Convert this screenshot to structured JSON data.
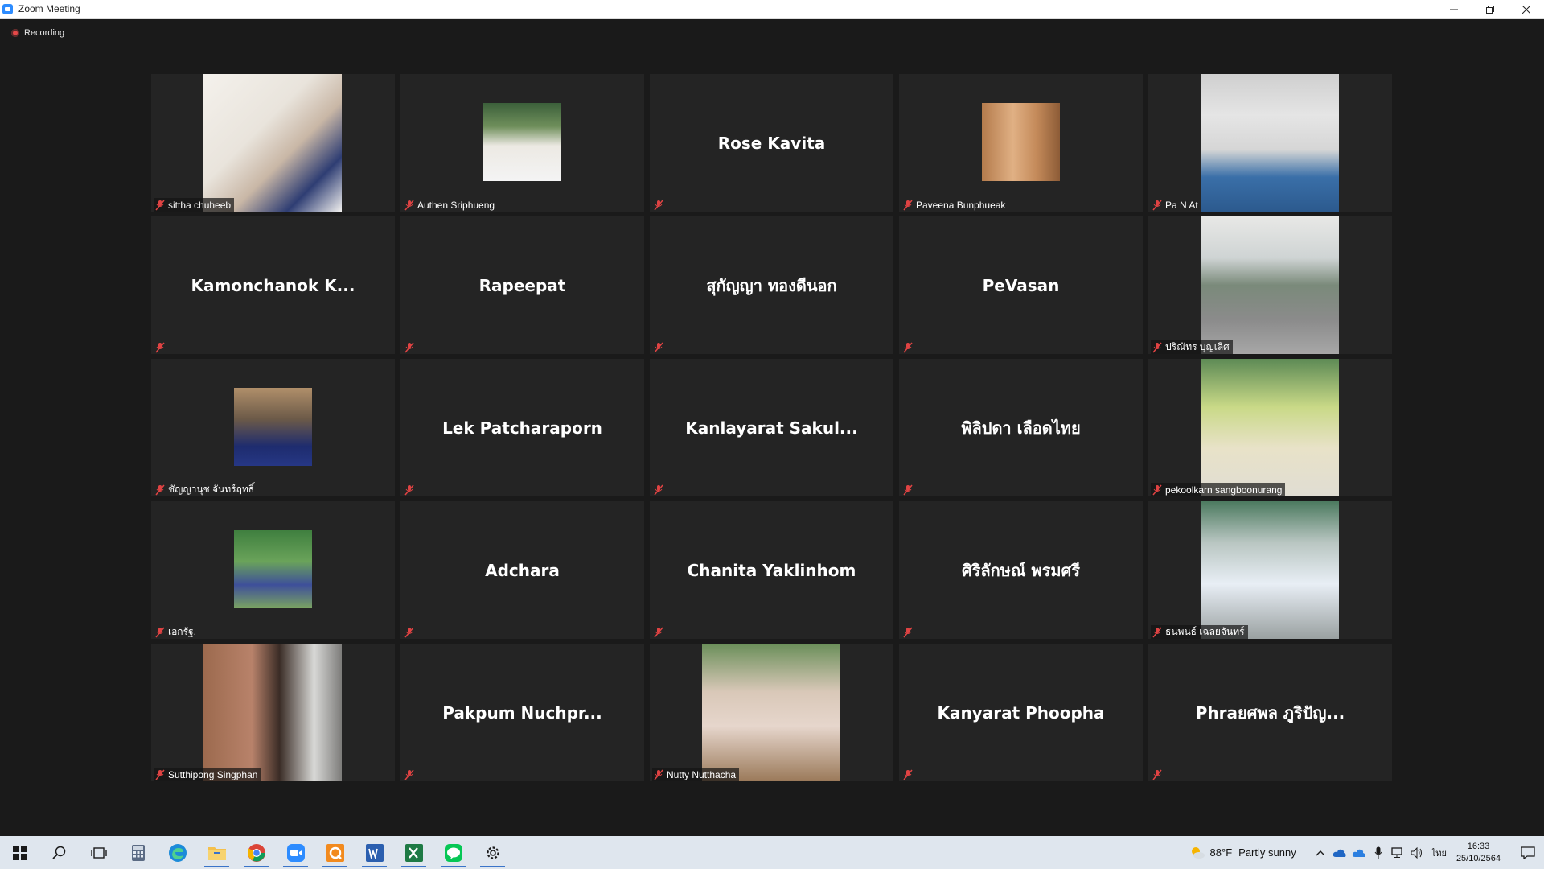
{
  "window": {
    "title": "Zoom Meeting"
  },
  "meeting": {
    "recording_label": "Recording"
  },
  "participants": [
    {
      "name": "sittha chuheeb",
      "has_video": true,
      "muted": true
    },
    {
      "name": "Authen Sriphueng",
      "has_video": true,
      "muted": true
    },
    {
      "name": "Rose Kavita",
      "has_video": false,
      "muted": true
    },
    {
      "name": "Paveena Bunphueak",
      "has_video": true,
      "muted": true
    },
    {
      "name": "Pa N At",
      "has_video": true,
      "muted": true
    },
    {
      "name": "Kamonchanok  K...",
      "has_video": false,
      "muted": true
    },
    {
      "name": "Rapeepat",
      "has_video": false,
      "muted": true
    },
    {
      "name": "สุกัญญา ทองดีนอก",
      "has_video": false,
      "muted": true
    },
    {
      "name": "PeVasan",
      "has_video": false,
      "muted": true
    },
    {
      "name": "ปริณัทร บุญเลิศ",
      "has_video": true,
      "muted": true
    },
    {
      "name": "ชัญญานุช จันทร์ฤทธิ์",
      "has_video": true,
      "muted": true
    },
    {
      "name": "Lek Patcharaporn",
      "has_video": false,
      "muted": true
    },
    {
      "name": "Kanlayarat  Sakul...",
      "has_video": false,
      "muted": true
    },
    {
      "name": "พิลิปดา  เลือดไทย",
      "has_video": false,
      "muted": true
    },
    {
      "name": "pekoolkarn sangboonurang",
      "has_video": true,
      "muted": true
    },
    {
      "name": "เอกรัฐ.",
      "has_video": true,
      "muted": true
    },
    {
      "name": "Adchara",
      "has_video": false,
      "muted": true
    },
    {
      "name": "Chanita Yaklinhom",
      "has_video": false,
      "muted": true
    },
    {
      "name": "ศิริลักษณ์ พรมศรี",
      "has_video": false,
      "muted": true
    },
    {
      "name": "ธนพนธ์ เฉลยจันทร์",
      "has_video": true,
      "muted": true
    },
    {
      "name": "Sutthipong Singphan",
      "has_video": true,
      "muted": true
    },
    {
      "name": "Pakpum  Nuchpr...",
      "has_video": false,
      "muted": true
    },
    {
      "name": "Nutty Nutthacha",
      "has_video": true,
      "muted": true
    },
    {
      "name": "Kanyarat Phoopha",
      "has_video": false,
      "muted": true
    },
    {
      "name": "Phraยศพล ภูริปัญ...",
      "has_video": false,
      "muted": true
    }
  ],
  "taskbar": {
    "weather_temp": "88°F",
    "weather_condition": "Partly sunny",
    "language": "ไทย",
    "time": "16:33",
    "date": "25/10/2564",
    "accent_color": "#3a74c9"
  }
}
